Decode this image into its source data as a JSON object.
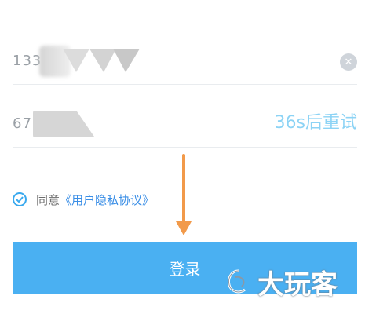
{
  "phone_field": {
    "value_visible": "133",
    "clear_icon": "close-icon"
  },
  "code_field": {
    "value_visible": "67",
    "resend_label": "36s后重试"
  },
  "agreement": {
    "prefix": "同意",
    "link": "《用户隐私协议》",
    "check_icon": "check-circle-icon"
  },
  "login": {
    "label": "登录"
  },
  "watermark": {
    "text": "大玩客"
  },
  "colors": {
    "accent": "#4ab0f2",
    "resend": "#8cd3f5",
    "annotation_arrow": "#f29a4a"
  }
}
